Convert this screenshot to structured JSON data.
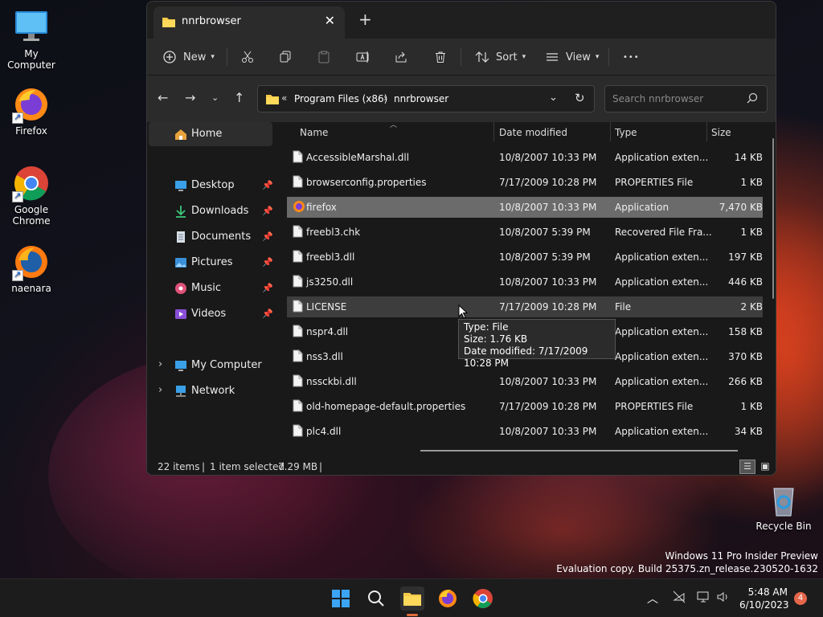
{
  "desktop": {
    "icons": [
      {
        "label": "My Computer"
      },
      {
        "label": "Firefox"
      },
      {
        "label": "Google Chrome"
      },
      {
        "label": "naenara"
      },
      {
        "label": "Recycle Bin"
      }
    ],
    "watermark_line1": "Windows 11 Pro Insider Preview",
    "watermark_line2": "Evaluation copy. Build 25375.zn_release.230520-1632"
  },
  "window": {
    "tab_title": "nnrbrowser",
    "toolbar": {
      "new_label": "New",
      "sort_label": "Sort",
      "view_label": "View",
      "more_label": "•••"
    },
    "breadcrumb": {
      "overflow": "«",
      "parent": "Program Files (x86)",
      "sep": "›",
      "current": "nnrbrowser"
    },
    "search_placeholder": "Search nnrbrowser",
    "sidebar": {
      "home": "Home",
      "pinned": [
        {
          "label": "Desktop",
          "icon": "desktop-icon"
        },
        {
          "label": "Downloads",
          "icon": "downloads-icon"
        },
        {
          "label": "Documents",
          "icon": "documents-icon"
        },
        {
          "label": "Pictures",
          "icon": "pictures-icon"
        },
        {
          "label": "Music",
          "icon": "music-icon"
        },
        {
          "label": "Videos",
          "icon": "videos-icon"
        }
      ],
      "my_computer": "My Computer",
      "network": "Network"
    },
    "columns": {
      "name": "Name",
      "date": "Date modified",
      "type": "Type",
      "size": "Size"
    },
    "files": [
      {
        "name": "AccessibleMarshal.dll",
        "date": "10/8/2007 10:33 PM",
        "type": "Application exten...",
        "size": "14 KB"
      },
      {
        "name": "browserconfig.properties",
        "date": "7/17/2009 10:28 PM",
        "type": "PROPERTIES File",
        "size": "1 KB"
      },
      {
        "name": "firefox",
        "date": "10/8/2007 10:33 PM",
        "type": "Application",
        "size": "7,470 KB"
      },
      {
        "name": "freebl3.chk",
        "date": "10/8/2007 5:39 PM",
        "type": "Recovered File Fra...",
        "size": "1 KB"
      },
      {
        "name": "freebl3.dll",
        "date": "10/8/2007 5:39 PM",
        "type": "Application exten...",
        "size": "197 KB"
      },
      {
        "name": "js3250.dll",
        "date": "10/8/2007 10:33 PM",
        "type": "Application exten...",
        "size": "446 KB"
      },
      {
        "name": "LICENSE",
        "date": "7/17/2009 10:28 PM",
        "type": "File",
        "size": "2 KB"
      },
      {
        "name": "nspr4.dll",
        "date": "",
        "type": "Application exten...",
        "size": "158 KB"
      },
      {
        "name": "nss3.dll",
        "date": "",
        "type": "Application exten...",
        "size": "370 KB"
      },
      {
        "name": "nssckbi.dll",
        "date": "10/8/2007 10:33 PM",
        "type": "Application exten...",
        "size": "266 KB"
      },
      {
        "name": "old-homepage-default.properties",
        "date": "7/17/2009 10:28 PM",
        "type": "PROPERTIES File",
        "size": "1 KB"
      },
      {
        "name": "plc4.dll",
        "date": "10/8/2007 10:33 PM",
        "type": "Application exten...",
        "size": "34 KB"
      }
    ],
    "status": {
      "items": "22 items",
      "selected": "1 item selected",
      "size": "7.29 MB"
    },
    "tooltip": {
      "line1": "Type: File",
      "line2": "Size: 1.76 KB",
      "line3": "Date modified: 7/17/2009 10:28 PM"
    }
  },
  "taskbar": {
    "time": "5:48 AM",
    "date": "6/10/2023",
    "notification_count": "4"
  }
}
